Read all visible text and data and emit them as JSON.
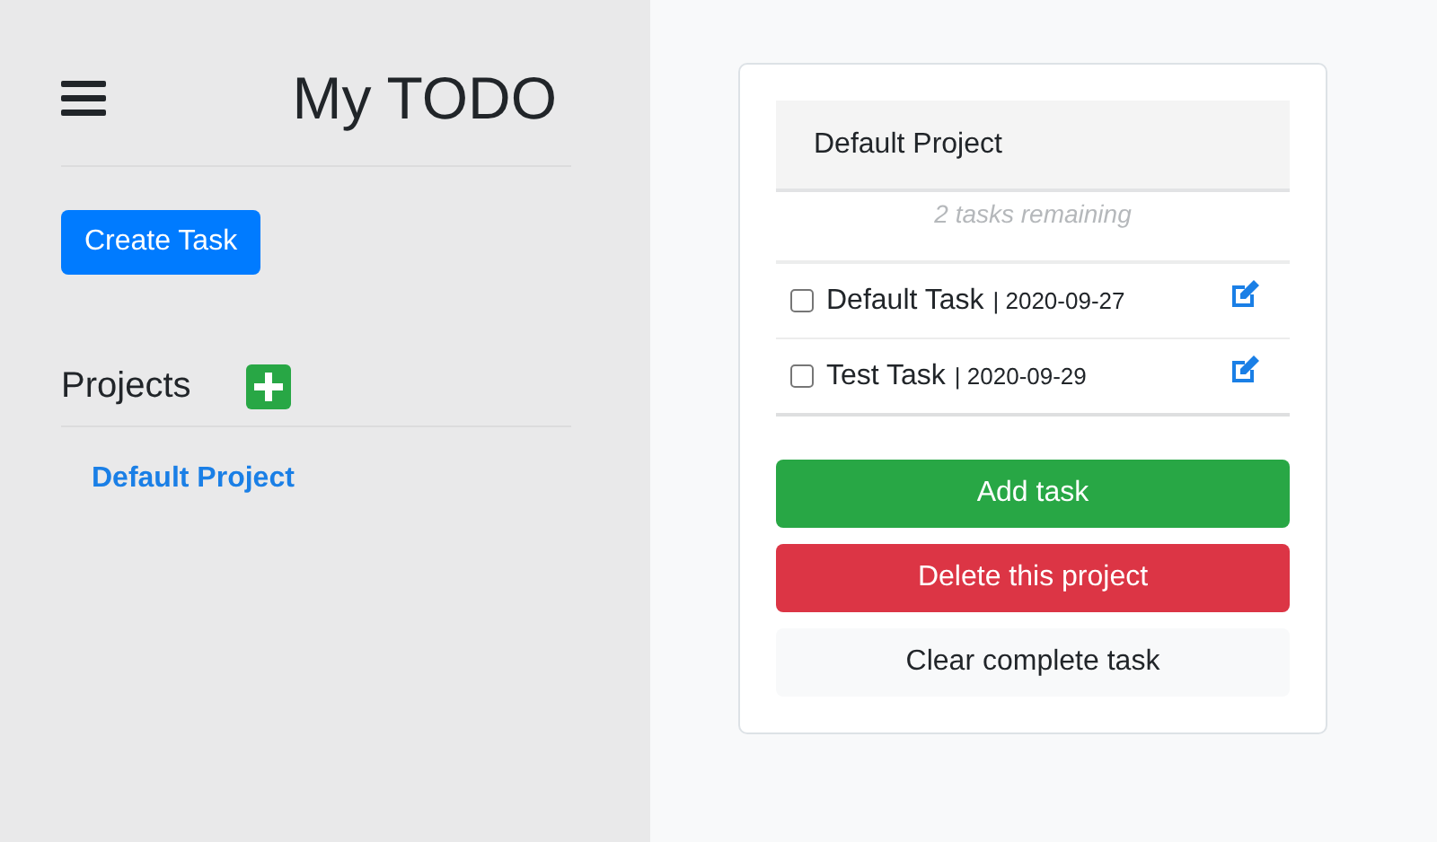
{
  "sidebar": {
    "title": "My TODO",
    "create_button": "Create Task",
    "projects_heading": "Projects",
    "projects": [
      {
        "name": "Default Project",
        "selected": true
      }
    ]
  },
  "project_card": {
    "title": "Default Project",
    "remaining": "2 tasks remaining",
    "tasks": [
      {
        "name": "Default Task",
        "date": "| 2020-09-27",
        "checked": false
      },
      {
        "name": "Test Task",
        "date": "| 2020-09-29",
        "checked": false
      }
    ],
    "actions": [
      {
        "label": "Add task",
        "kind": "success"
      },
      {
        "label": "Delete this project",
        "kind": "danger"
      },
      {
        "label": "Clear complete task",
        "kind": "light"
      }
    ]
  }
}
